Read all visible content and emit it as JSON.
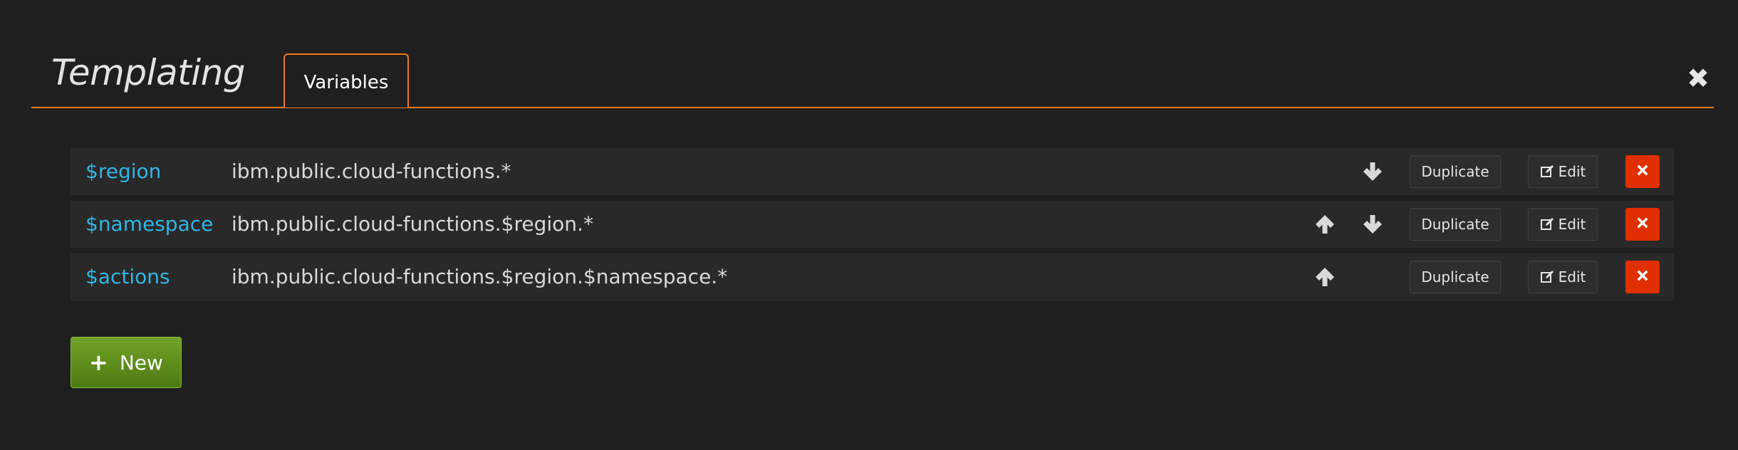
{
  "header": {
    "title": "Templating",
    "tab_label": "Variables",
    "close_glyph": "✖"
  },
  "variables": [
    {
      "name": "$region",
      "query": "ibm.public.cloud-functions.*",
      "duplicate_label": "Duplicate",
      "edit_label": "Edit"
    },
    {
      "name": "$namespace",
      "query": "ibm.public.cloud-functions.$region.*",
      "duplicate_label": "Duplicate",
      "edit_label": "Edit"
    },
    {
      "name": "$actions",
      "query": "ibm.public.cloud-functions.$region.$namespace.*",
      "duplicate_label": "Duplicate",
      "edit_label": "Edit"
    }
  ],
  "new_button": {
    "plus_glyph": "+",
    "label": "New"
  },
  "icons": {
    "up": "arrow-up-icon",
    "down": "arrow-down-icon",
    "edit": "edit-icon",
    "delete": "times-icon",
    "close": "close-icon"
  },
  "colors": {
    "accent": "#eb7b18",
    "variable_name": "#33b5e5",
    "danger": "#e02f00",
    "success": "#5c8c1a"
  }
}
